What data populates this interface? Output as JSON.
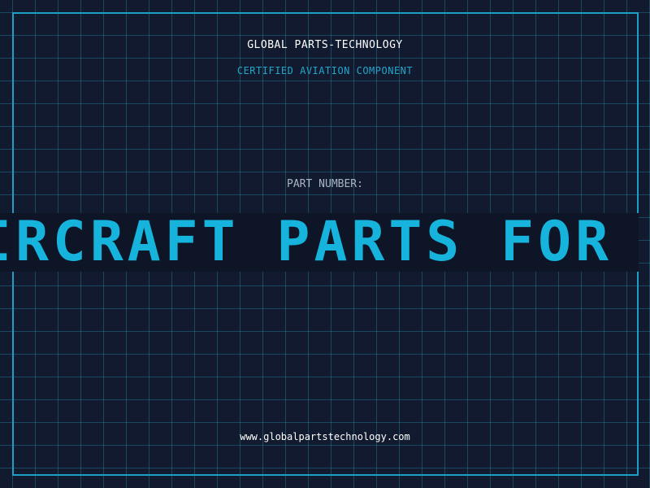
{
  "header": {
    "company_name": "GLOBAL PARTS-TECHNOLOGY",
    "subtitle": "CERTIFIED AVIATION COMPONENT"
  },
  "main": {
    "part_number_label": "PART NUMBER:",
    "marquee_text": "IRCRAFT PARTS FOR"
  },
  "footer": {
    "website": "www.globalpartstechnology.com"
  },
  "colors": {
    "background": "#111a2e",
    "grid": "#2896aa",
    "frame": "#1aa0c4",
    "accent": "#16b4dc",
    "label": "#a9b5c7"
  }
}
